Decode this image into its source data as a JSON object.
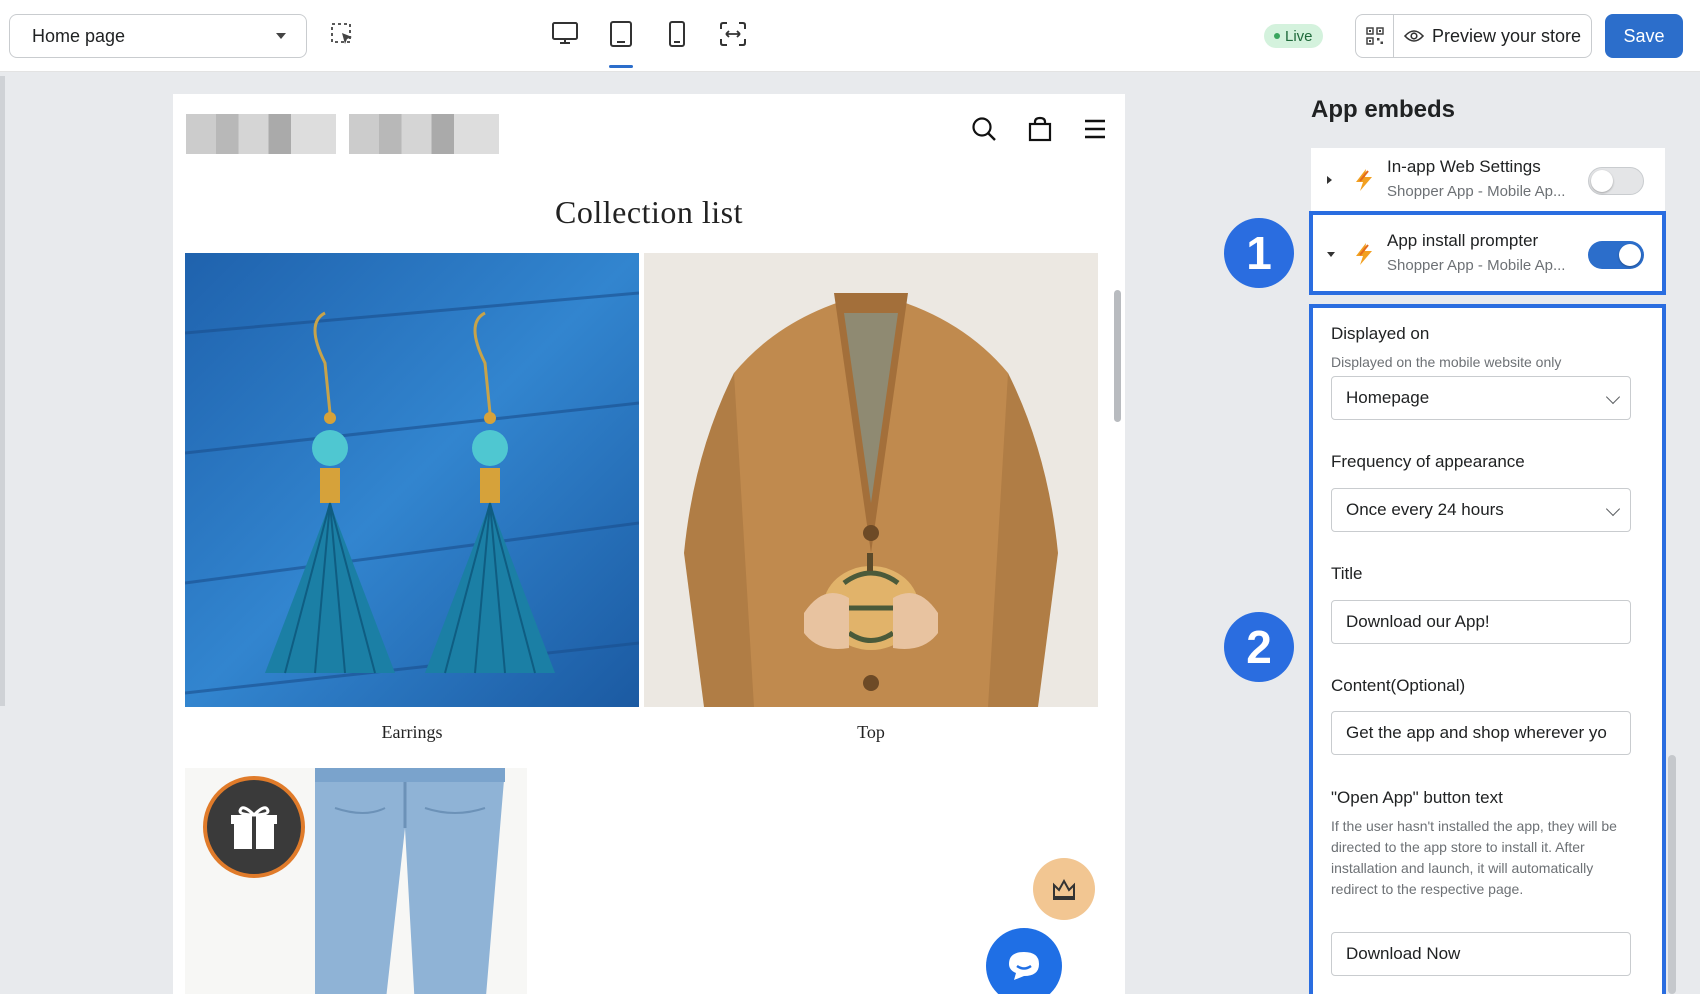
{
  "toolbar": {
    "page_select": "Home page",
    "live_label": "Live",
    "preview_label": "Preview your store",
    "save_label": "Save"
  },
  "store": {
    "collection_title": "Collection list",
    "collections": [
      {
        "label": "Earrings"
      },
      {
        "label": "Top"
      }
    ]
  },
  "panel": {
    "title": "App embeds",
    "embeds": [
      {
        "name": "In-app Web Settings",
        "subtitle": "Shopper App - Mobile Ap...",
        "enabled": false
      },
      {
        "name": "App install prompter",
        "subtitle": "Shopper App - Mobile Ap...",
        "enabled": true
      }
    ],
    "markers": [
      "1",
      "2"
    ],
    "settings": {
      "displayed_on_label": "Displayed on",
      "displayed_on_help": "Displayed on the mobile website only",
      "displayed_on_value": "Homepage",
      "frequency_label": "Frequency of appearance",
      "frequency_value": "Once every 24 hours",
      "title_label": "Title",
      "title_value": "Download our App!",
      "content_label": "Content(Optional)",
      "content_value": "Get the app and shop wherever yo",
      "open_app_label": "\"Open App\" button text",
      "open_app_help": "If the user hasn't installed the app, they will be directed to the app store to install it. After installation and launch, it will automatically redirect to the respective page.",
      "open_app_value": "Download Now"
    }
  },
  "colors": {
    "accent": "#2c6ecb",
    "highlight": "#2a6de0",
    "live_bg": "#d4f2dd",
    "chat": "#1f6fe5"
  }
}
